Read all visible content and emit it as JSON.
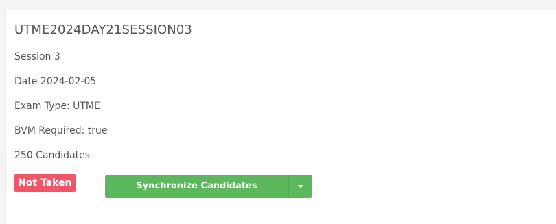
{
  "session": {
    "code": "UTME2024DAY21SESSION03",
    "name": "Session 3",
    "date_line": "Date 2024-02-05",
    "exam_type_line": "Exam Type: UTME",
    "bvm_line": "BVM Required: true",
    "candidates_line": "250 Candidates"
  },
  "status": {
    "label": "Not Taken",
    "color": "#ef5767"
  },
  "actions": {
    "sync_label": "Synchronize Candidates",
    "toggle_icon": "caret-down-icon",
    "color": "#5cb85c"
  }
}
